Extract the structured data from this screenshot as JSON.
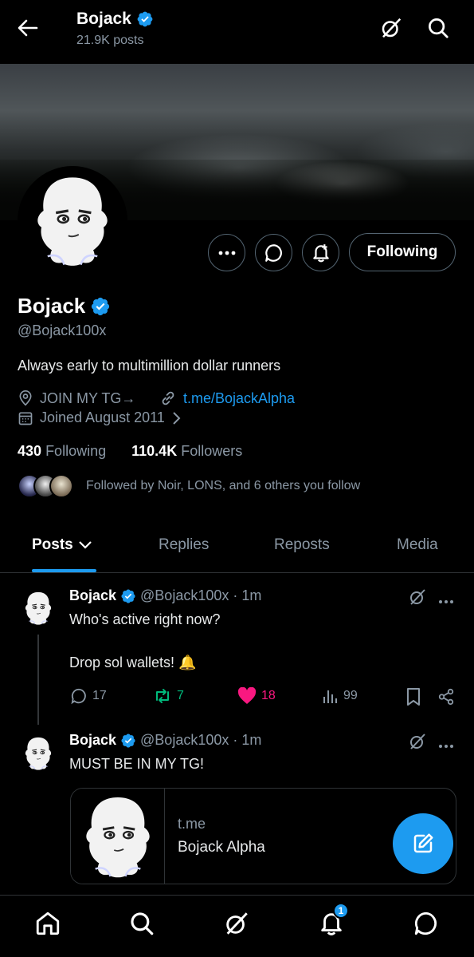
{
  "header": {
    "title": "Bojack",
    "subtitle": "21.9K posts"
  },
  "profile": {
    "display_name": "Bojack",
    "handle": "@Bojack100x",
    "bio": "Always early to multimillion dollar runners",
    "location": "JOIN MY TG→",
    "website": "t.me/BojackAlpha",
    "joined": "Joined August 2011",
    "following_count": "430",
    "following_label": "Following",
    "followers_count": "110.4K",
    "followers_label": "Followers",
    "followed_by": "Followed by Noir, LONS, and 6 others you follow",
    "follow_button_label": "Following"
  },
  "tabs": [
    {
      "label": "Posts"
    },
    {
      "label": "Replies"
    },
    {
      "label": "Reposts"
    },
    {
      "label": "Media"
    }
  ],
  "posts": [
    {
      "name": "Bojack",
      "handle_time": "@Bojack100x · 1m",
      "line1": "Who's active right now?",
      "line2": "Drop sol wallets! 🔔",
      "replies": "17",
      "reposts": "7",
      "likes": "18",
      "views": "99"
    },
    {
      "name": "Bojack",
      "handle_time": "@Bojack100x · 1m",
      "line1": "MUST BE IN MY TG!",
      "card_domain": "t.me",
      "card_title": "Bojack Alpha"
    }
  ],
  "notifications_badge": "1",
  "colors": {
    "accent": "#1d9bf0",
    "repost": "#00ba7c",
    "like": "#f91880",
    "muted": "#8b98a5"
  },
  "icons": [
    "back-arrow-icon",
    "verified-badge-icon",
    "grok-icon",
    "search-icon",
    "more-icon",
    "message-icon",
    "bell-plus-icon",
    "location-icon",
    "link-icon",
    "calendar-icon",
    "chevron-down-icon",
    "reply-icon",
    "repost-icon",
    "like-icon",
    "views-icon",
    "bookmark-icon",
    "share-icon",
    "compose-icon",
    "home-icon",
    "notifications-icon"
  ]
}
